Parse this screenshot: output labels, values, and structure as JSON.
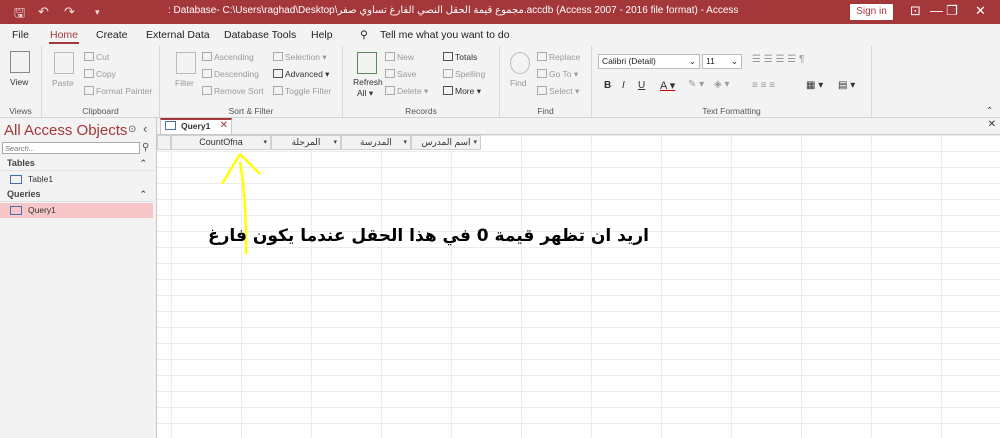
{
  "titlebar": {
    "title": ": Database- C:\\Users\\raghad\\Desktop\\مجموع قيمة الحقل النصي الفارغ تساوي صفر.accdb (Access 2007 - 2016 file format) - Access",
    "title_prefix": "مجموع قيمة الحقل النصي الفارغ تساوي صفر",
    "signin_label": "Sign in"
  },
  "menu": {
    "items": [
      "File",
      "Home",
      "Create",
      "External Data",
      "Database Tools",
      "Help"
    ],
    "active": "Home",
    "tell_me": "Tell me what you want to do"
  },
  "ribbon": {
    "views": {
      "view_label": "View",
      "group_label": "Views"
    },
    "clipboard": {
      "paste": "Paste",
      "cut": "Cut",
      "copy": "Copy",
      "format_painter": "Format Painter",
      "group_label": "Clipboard"
    },
    "sort_filter": {
      "filter": "Filter",
      "ascending": "Ascending",
      "descending": "Descending",
      "remove_sort": "Remove Sort",
      "selection": "Selection",
      "advanced": "Advanced",
      "toggle_filter": "Toggle Filter",
      "group_label": "Sort & Filter"
    },
    "records": {
      "refresh": "Refresh",
      "refresh_all": "All",
      "new": "New",
      "save": "Save",
      "delete": "Delete",
      "totals": "Totals",
      "spelling": "Spelling",
      "more": "More",
      "group_label": "Records"
    },
    "find": {
      "find": "Find",
      "replace": "Replace",
      "goto": "Go To",
      "select": "Select",
      "group_label": "Find"
    },
    "text_formatting": {
      "font": "Calibri (Detail)",
      "size": "11",
      "bold": "B",
      "italic": "I",
      "underline": "U",
      "group_label": "Text Formatting"
    }
  },
  "nav": {
    "title": "All Access Objects",
    "search_placeholder": "Search...",
    "sections": [
      {
        "label": "Tables",
        "items": [
          "Table1"
        ]
      },
      {
        "label": "Queries",
        "items": [
          "Query1"
        ]
      }
    ]
  },
  "tabs": {
    "query_tab": "Query1"
  },
  "grid": {
    "columns": [
      "CountOfna",
      "المرحلة",
      "المدرسة",
      "اسم المدرس"
    ]
  },
  "annotation": {
    "text": "اريد ان تظهر قيمة 0 في هذا الحقل عندما يكون فارغ",
    "color": "#000000",
    "arrow_color": "#ffff00"
  },
  "colors": {
    "accent": "#a4373a",
    "selected_item": "#f7c6c8"
  }
}
